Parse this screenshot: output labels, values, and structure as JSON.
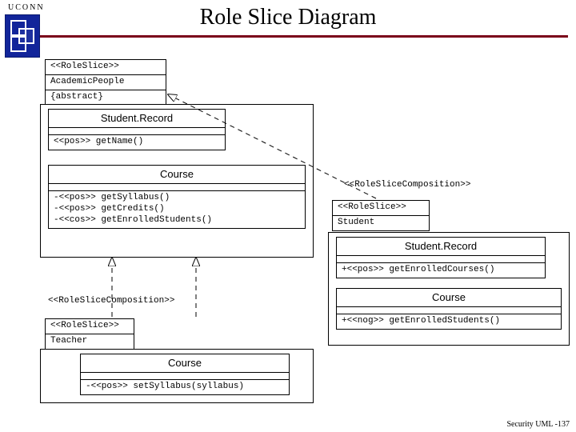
{
  "header": {
    "uconn": "UCONN",
    "title": "Role Slice Diagram"
  },
  "footer": "Security UML -137",
  "stereotypes": {
    "roleslice": "<<RoleSlice>>",
    "abstract": "{abstract}",
    "comp_right": "<<RoleSliceComposition>>",
    "comp_left": "<<RoleSliceComposition>>"
  },
  "top_box": {
    "name": "AcademicPeople",
    "ster": "<<RoleSlice>>",
    "mod": "{abstract}"
  },
  "student_record_left": {
    "name": "Student.Record",
    "ops": [
      "<<pos>> getName()"
    ]
  },
  "course_left": {
    "name": "Course",
    "ops": [
      "-<<pos>> getSyllabus()",
      "-<<pos>> getCredits()",
      "-<<cos>> getEnrolledStudents()"
    ]
  },
  "student_role": {
    "ster": "<<RoleSlice>>",
    "name": "Student"
  },
  "student_record_right": {
    "name": "Student.Record",
    "ops": [
      "+<<pos>> getEnrolledCourses()"
    ]
  },
  "course_right": {
    "name": "Course",
    "ops": [
      "+<<nog>> getEnrolledStudents()"
    ]
  },
  "teacher_role": {
    "ster": "<<RoleSlice>>",
    "name": "Teacher"
  },
  "course_bottom": {
    "name": "Course",
    "ops": [
      "-<<pos>> setSyllabus(syllabus)"
    ]
  }
}
